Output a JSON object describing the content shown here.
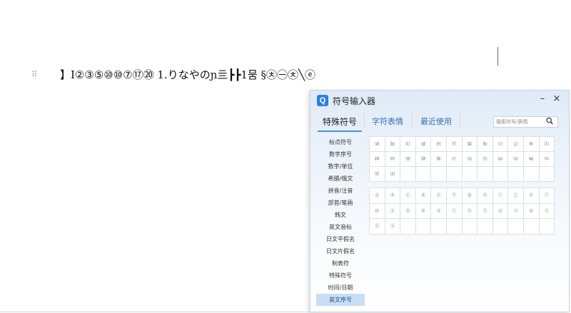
{
  "document": {
    "drag_handle": "⠿",
    "symbol_line": "】Ⅰ②③⑤⑩⑩⑦⑰⑳ 1.りなやのɲ亖┣┣1뭄 §㉩㊀㉩╲ⓔ"
  },
  "dialog": {
    "title": "符号输入器",
    "minimize": "–",
    "close": "×",
    "tabs": [
      {
        "label": "特殊符号"
      },
      {
        "label": "字符表情"
      },
      {
        "label": "最近使用"
      }
    ],
    "search_placeholder": "搜索符号/表情",
    "categories": [
      {
        "label": "标点符号"
      },
      {
        "label": "数字序号"
      },
      {
        "label": "数字/单位"
      },
      {
        "label": "希腊/俄文"
      },
      {
        "label": "拼音/注音"
      },
      {
        "label": "部首/笔画"
      },
      {
        "label": "韩文"
      },
      {
        "label": "英文音标"
      },
      {
        "label": "日文平假名"
      },
      {
        "label": "日文片假名"
      },
      {
        "label": "制表符"
      },
      {
        "label": "特殊符号"
      },
      {
        "label": "时间/日期"
      },
      {
        "label": "英文序号"
      }
    ],
    "grid1_symbols": [
      "⒜",
      "⒝",
      "⒞",
      "⒟",
      "⒠",
      "⒡",
      "⒢",
      "⒣",
      "⒤",
      "⒥",
      "⒦",
      "⒧",
      "⒨",
      "⒩",
      "⒪",
      "⒫",
      "⒬",
      "⒭",
      "⒮",
      "⒯",
      "⒰",
      "⒱",
      "⒲",
      "⒳",
      "⒴",
      "⒵",
      "",
      "",
      "",
      "",
      "",
      "",
      "",
      "",
      "",
      ""
    ],
    "grid2_symbols": [
      "ⓐ",
      "ⓑ",
      "ⓒ",
      "ⓓ",
      "ⓔ",
      "ⓕ",
      "ⓖ",
      "ⓗ",
      "ⓘ",
      "ⓙ",
      "ⓚ",
      "ⓛ",
      "ⓜ",
      "ⓝ",
      "ⓞ",
      "ⓟ",
      "ⓠ",
      "ⓡ",
      "ⓢ",
      "ⓣ",
      "ⓤ",
      "ⓥ",
      "ⓦ",
      "ⓧ",
      "ⓨ",
      "ⓩ",
      "",
      "",
      "",
      "",
      "",
      "",
      "",
      "",
      "",
      ""
    ]
  },
  "colors": {
    "accent": "#4a90e2",
    "active_category_bg": "#c9def3",
    "logo": "#2f7de1"
  }
}
